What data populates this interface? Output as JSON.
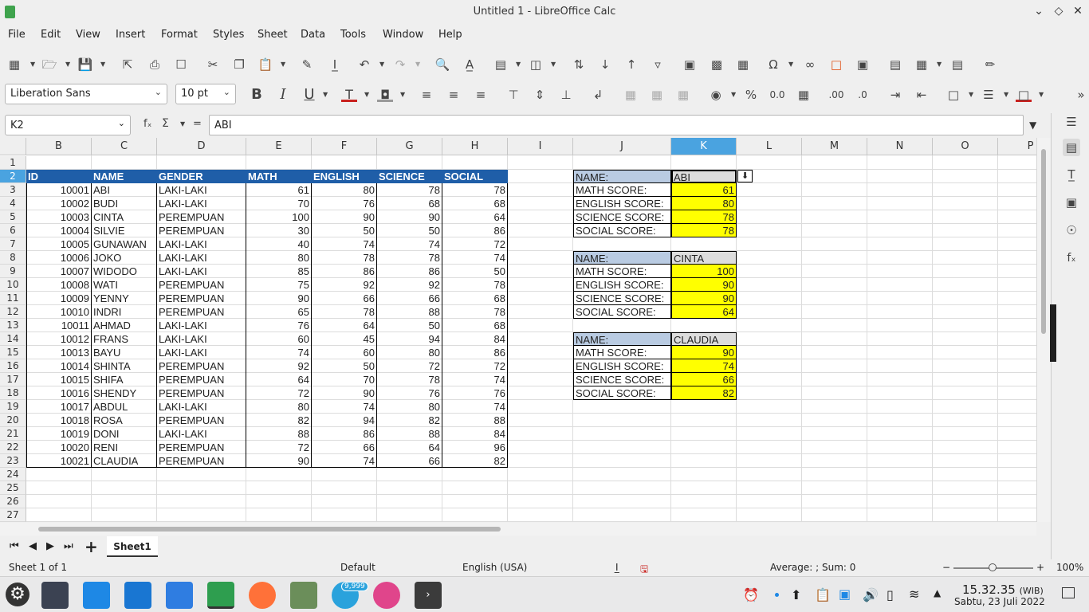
{
  "window": {
    "title": "Untitled 1 - LibreOffice Calc"
  },
  "menu": [
    "File",
    "Edit",
    "View",
    "Insert",
    "Format",
    "Styles",
    "Sheet",
    "Data",
    "Tools",
    "Window",
    "Help"
  ],
  "font": {
    "name": "Liberation Sans",
    "size": "10 pt"
  },
  "namebox": "K2",
  "formula": {
    "content": "ABI",
    "fx": "fₓ",
    "sum": "Σ",
    "eq": "="
  },
  "columns": [
    "B",
    "C",
    "D",
    "E",
    "F",
    "G",
    "H",
    "I",
    "J",
    "K",
    "L",
    "M",
    "N",
    "O",
    "P"
  ],
  "rows": [
    "1",
    "2",
    "3",
    "4",
    "5",
    "6",
    "7",
    "8",
    "9",
    "10",
    "11",
    "12",
    "13",
    "14",
    "15",
    "16",
    "17",
    "18",
    "19",
    "20",
    "21",
    "22",
    "23",
    "24",
    "25",
    "26",
    "27"
  ],
  "table": {
    "headers": [
      "ID",
      "NAME",
      "GENDER",
      "MATH",
      "ENGLISH",
      "SCIENCE",
      "SOCIAL"
    ],
    "rows": [
      [
        "10001",
        "ABI",
        "LAKI-LAKI",
        "61",
        "80",
        "78",
        "78"
      ],
      [
        "10002",
        "BUDI",
        "LAKI-LAKI",
        "70",
        "76",
        "68",
        "68"
      ],
      [
        "10003",
        "CINTA",
        "PEREMPUAN",
        "100",
        "90",
        "90",
        "64"
      ],
      [
        "10004",
        "SILVIE",
        "PEREMPUAN",
        "30",
        "50",
        "50",
        "86"
      ],
      [
        "10005",
        "GUNAWAN",
        "LAKI-LAKI",
        "40",
        "74",
        "74",
        "72"
      ],
      [
        "10006",
        "JOKO",
        "LAKI-LAKI",
        "80",
        "78",
        "78",
        "74"
      ],
      [
        "10007",
        "WIDODO",
        "LAKI-LAKI",
        "85",
        "86",
        "86",
        "50"
      ],
      [
        "10008",
        "WATI",
        "PEREMPUAN",
        "75",
        "92",
        "92",
        "78"
      ],
      [
        "10009",
        "YENNY",
        "PEREMPUAN",
        "90",
        "66",
        "66",
        "68"
      ],
      [
        "10010",
        "INDRI",
        "PEREMPUAN",
        "65",
        "78",
        "88",
        "78"
      ],
      [
        "10011",
        "AHMAD",
        "LAKI-LAKI",
        "76",
        "64",
        "50",
        "68"
      ],
      [
        "10012",
        "FRANS",
        "LAKI-LAKI",
        "60",
        "45",
        "94",
        "84"
      ],
      [
        "10013",
        "BAYU",
        "LAKI-LAKI",
        "74",
        "60",
        "80",
        "86"
      ],
      [
        "10014",
        "SHINTA",
        "PEREMPUAN",
        "92",
        "50",
        "72",
        "72"
      ],
      [
        "10015",
        "SHIFA",
        "PEREMPUAN",
        "64",
        "70",
        "78",
        "74"
      ],
      [
        "10016",
        "SHENDY",
        "PEREMPUAN",
        "72",
        "90",
        "76",
        "76"
      ],
      [
        "10017",
        "ABDUL",
        "LAKI-LAKI",
        "80",
        "74",
        "80",
        "74"
      ],
      [
        "10018",
        "ROSA",
        "PEREMPUAN",
        "82",
        "94",
        "82",
        "88"
      ],
      [
        "10019",
        "DONI",
        "LAKI-LAKI",
        "88",
        "86",
        "88",
        "84"
      ],
      [
        "10020",
        "RENI",
        "PEREMPUAN",
        "72",
        "66",
        "64",
        "96"
      ],
      [
        "10021",
        "CLAUDIA",
        "PEREMPUAN",
        "90",
        "74",
        "66",
        "82"
      ]
    ]
  },
  "lookups": [
    {
      "name_label": "NAME:",
      "name": "ABI",
      "items": [
        [
          "MATH SCORE:",
          "61"
        ],
        [
          "ENGLISH SCORE:",
          "80"
        ],
        [
          "SCIENCE SCORE:",
          "78"
        ],
        [
          "SOCIAL SCORE:",
          "78"
        ]
      ]
    },
    {
      "name_label": "NAME:",
      "name": "CINTA",
      "items": [
        [
          "MATH SCORE:",
          "100"
        ],
        [
          "ENGLISH SCORE:",
          "90"
        ],
        [
          "SCIENCE SCORE:",
          "90"
        ],
        [
          "SOCIAL SCORE:",
          "64"
        ]
      ]
    },
    {
      "name_label": "NAME:",
      "name": "CLAUDIA",
      "items": [
        [
          "MATH SCORE:",
          "90"
        ],
        [
          "ENGLISH SCORE:",
          "74"
        ],
        [
          "SCIENCE SCORE:",
          "66"
        ],
        [
          "SOCIAL SCORE:",
          "82"
        ]
      ]
    }
  ],
  "sheet_tab": "Sheet1",
  "status": {
    "sheet": "Sheet 1 of 1",
    "style": "Default",
    "lang": "English (USA)",
    "stats": "Average: ; Sum: 0",
    "zoom": "100%"
  },
  "clock": {
    "time": "15.32.35",
    "tz": "(WIB)",
    "date": "Sabtu, 23 Juli 2022"
  },
  "badge": "9,999",
  "colors": {
    "header_blue": "#1f5ea8",
    "label_blue": "#b9cbe2",
    "yellow": "#ffff00",
    "selection": "#4aa3e0"
  }
}
